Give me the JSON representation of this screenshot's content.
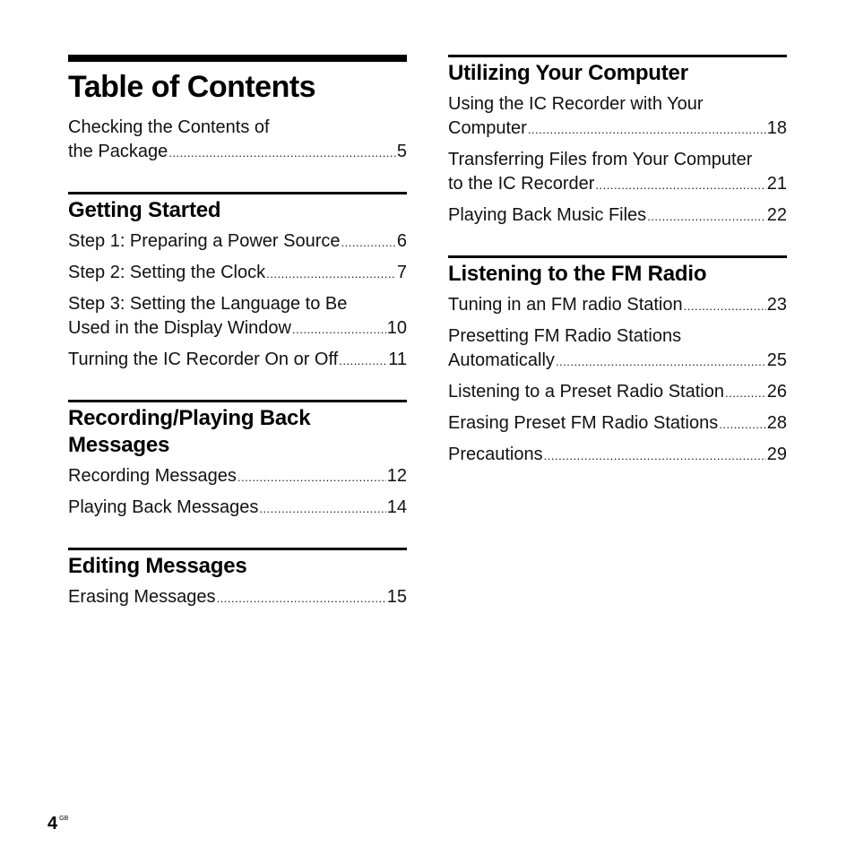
{
  "page_title": "Table of Contents",
  "intro": {
    "line1": "Checking the Contents of",
    "line2": "the Package",
    "page": "5"
  },
  "sections_left": [
    {
      "title": "Getting Started",
      "entries": [
        {
          "line1": "",
          "line2": "Step 1: Preparing a Power Source",
          "page": "6"
        },
        {
          "line1": "",
          "line2": "Step 2: Setting the Clock",
          "page": "7"
        },
        {
          "line1": "Step 3: Setting the Language to Be",
          "line2": "Used in the Display Window",
          "page": "10"
        },
        {
          "line1": "",
          "line2": "Turning the IC Recorder On or Off",
          "page": "11"
        }
      ]
    },
    {
      "title": "Recording/Playing Back Messages",
      "entries": [
        {
          "line1": "",
          "line2": "Recording Messages",
          "page": "12"
        },
        {
          "line1": "",
          "line2": "Playing Back Messages",
          "page": "14"
        }
      ]
    },
    {
      "title": "Editing Messages",
      "entries": [
        {
          "line1": "",
          "line2": "Erasing Messages",
          "page": "15"
        }
      ]
    }
  ],
  "sections_right": [
    {
      "title": "Utilizing Your Computer",
      "entries": [
        {
          "line1": "Using the IC Recorder with Your",
          "line2": "Computer",
          "page": "18"
        },
        {
          "line1": "Transferring Files from Your Computer",
          "line2": "to the IC Recorder",
          "page": "21"
        },
        {
          "line1": "",
          "line2": "Playing Back Music Files",
          "page": "22"
        }
      ]
    },
    {
      "title": "Listening to the FM Radio",
      "entries": [
        {
          "line1": "",
          "line2": "Tuning in an FM radio Station",
          "page": "23"
        },
        {
          "line1": "Presetting FM Radio Stations",
          "line2": "Automatically",
          "page": "25"
        },
        {
          "line1": "",
          "line2": "Listening to a Preset Radio Station",
          "page": "26"
        },
        {
          "line1": "",
          "line2": "Erasing Preset FM Radio Stations",
          "page": "28"
        },
        {
          "line1": "",
          "line2": "Precautions",
          "page": "29"
        }
      ]
    }
  ],
  "footer": {
    "page_number": "4",
    "page_suffix": "GB"
  }
}
